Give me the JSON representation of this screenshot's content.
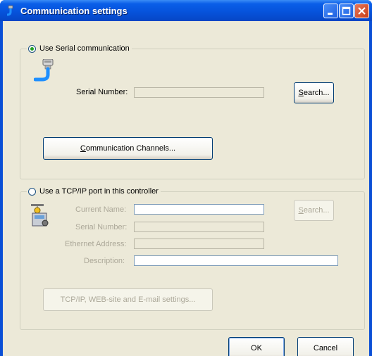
{
  "window": {
    "title": "Communication settings"
  },
  "serial_group": {
    "radio_label": "Use Serial communication",
    "selected": true,
    "serial_number_label": "Serial Number:",
    "serial_number_value": "",
    "search_label_first": "S",
    "search_label_rest": "earch...",
    "channels_label_first": "C",
    "channels_label_rest": "ommunication Channels..."
  },
  "tcp_group": {
    "radio_label": "Use a TCP/IP port in this controller",
    "selected": false,
    "current_name_label": "Current Name:",
    "current_name_value": "",
    "serial_number_label": "Serial Number:",
    "serial_number_value": "",
    "ethernet_address_label": "Ethernet Address:",
    "ethernet_address_value": "",
    "description_label": "Description:",
    "description_value": "",
    "search_label_first": "S",
    "search_label_rest": "earch...",
    "tcp_settings_label": "TCP/IP, WEB-site and E-mail settings..."
  },
  "buttons": {
    "ok_label": "OK",
    "cancel_label": "Cancel"
  },
  "icons": {
    "app": "connector-icon",
    "serial": "serial-connector-icon",
    "tcp": "network-controller-icon"
  }
}
